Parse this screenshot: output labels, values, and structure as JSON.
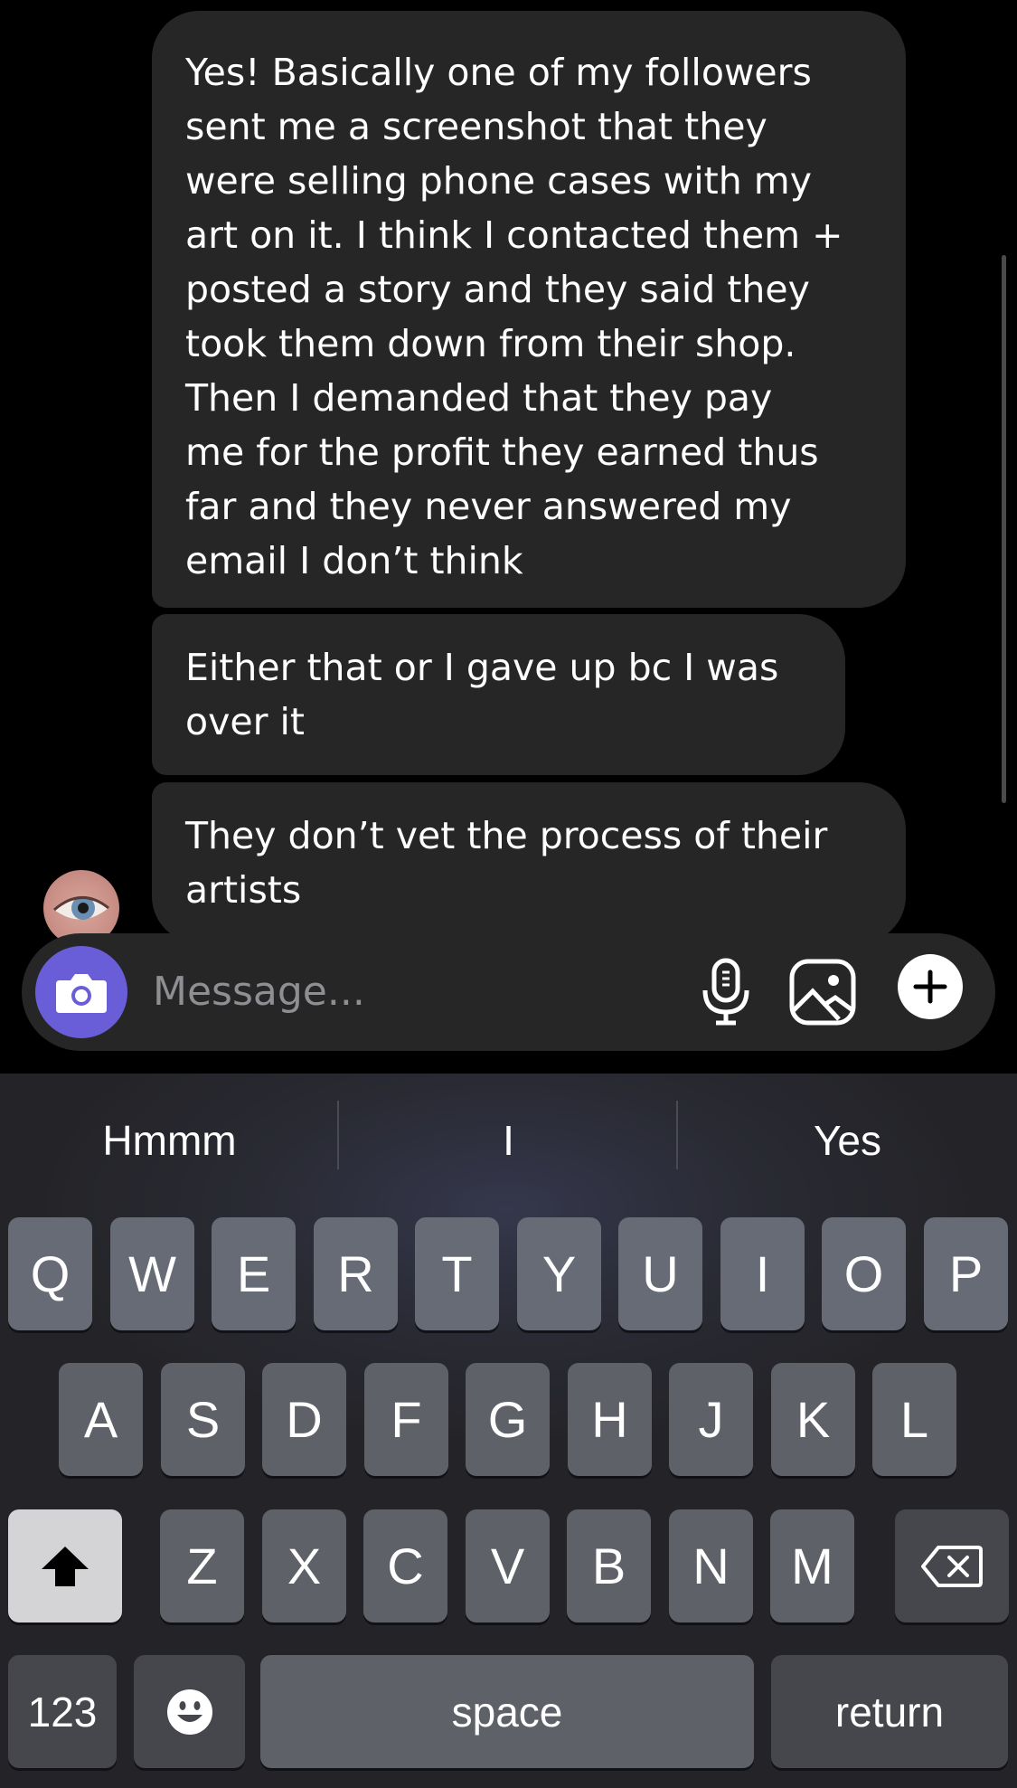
{
  "messages": [
    {
      "id": "msg1",
      "text": "Yes! Basically one of my followers\nsent me a screenshot that they\nwere selling phone cases with my\nart on it. I think I contacted them +\nposted a story and they said they\ntook them down from their shop.\nThen I demanded that they pay\nme for the profit they earned thus\nfar and they never answered my\nemail I don’t think"
    },
    {
      "id": "msg2",
      "text": "Either that or I gave up bc I was\nover it"
    },
    {
      "id": "msg3",
      "text": "They don’t vet the process of their\nartists"
    }
  ],
  "composer": {
    "placeholder": "Message...",
    "camera_icon": "camera-icon",
    "mic_icon": "microphone-icon",
    "gallery_icon": "image-icon",
    "plus_icon": "plus-icon"
  },
  "keyboard": {
    "suggestions": [
      "Hmmm",
      "I",
      "Yes"
    ],
    "row1": [
      "Q",
      "W",
      "E",
      "R",
      "T",
      "Y",
      "U",
      "I",
      "O",
      "P"
    ],
    "row2": [
      "A",
      "S",
      "D",
      "F",
      "G",
      "H",
      "J",
      "K",
      "L"
    ],
    "row3": [
      "Z",
      "X",
      "C",
      "V",
      "B",
      "N",
      "M"
    ],
    "numbers_label": "123",
    "space_label": "space",
    "return_label": "return",
    "shift_icon": "shift-arrow-icon",
    "delete_icon": "delete-icon",
    "emoji_icon": "emoji-icon"
  },
  "colors": {
    "background": "#000000",
    "bubble": "#262626",
    "accent": "#6a5ed8",
    "placeholder": "#8e8e93"
  }
}
